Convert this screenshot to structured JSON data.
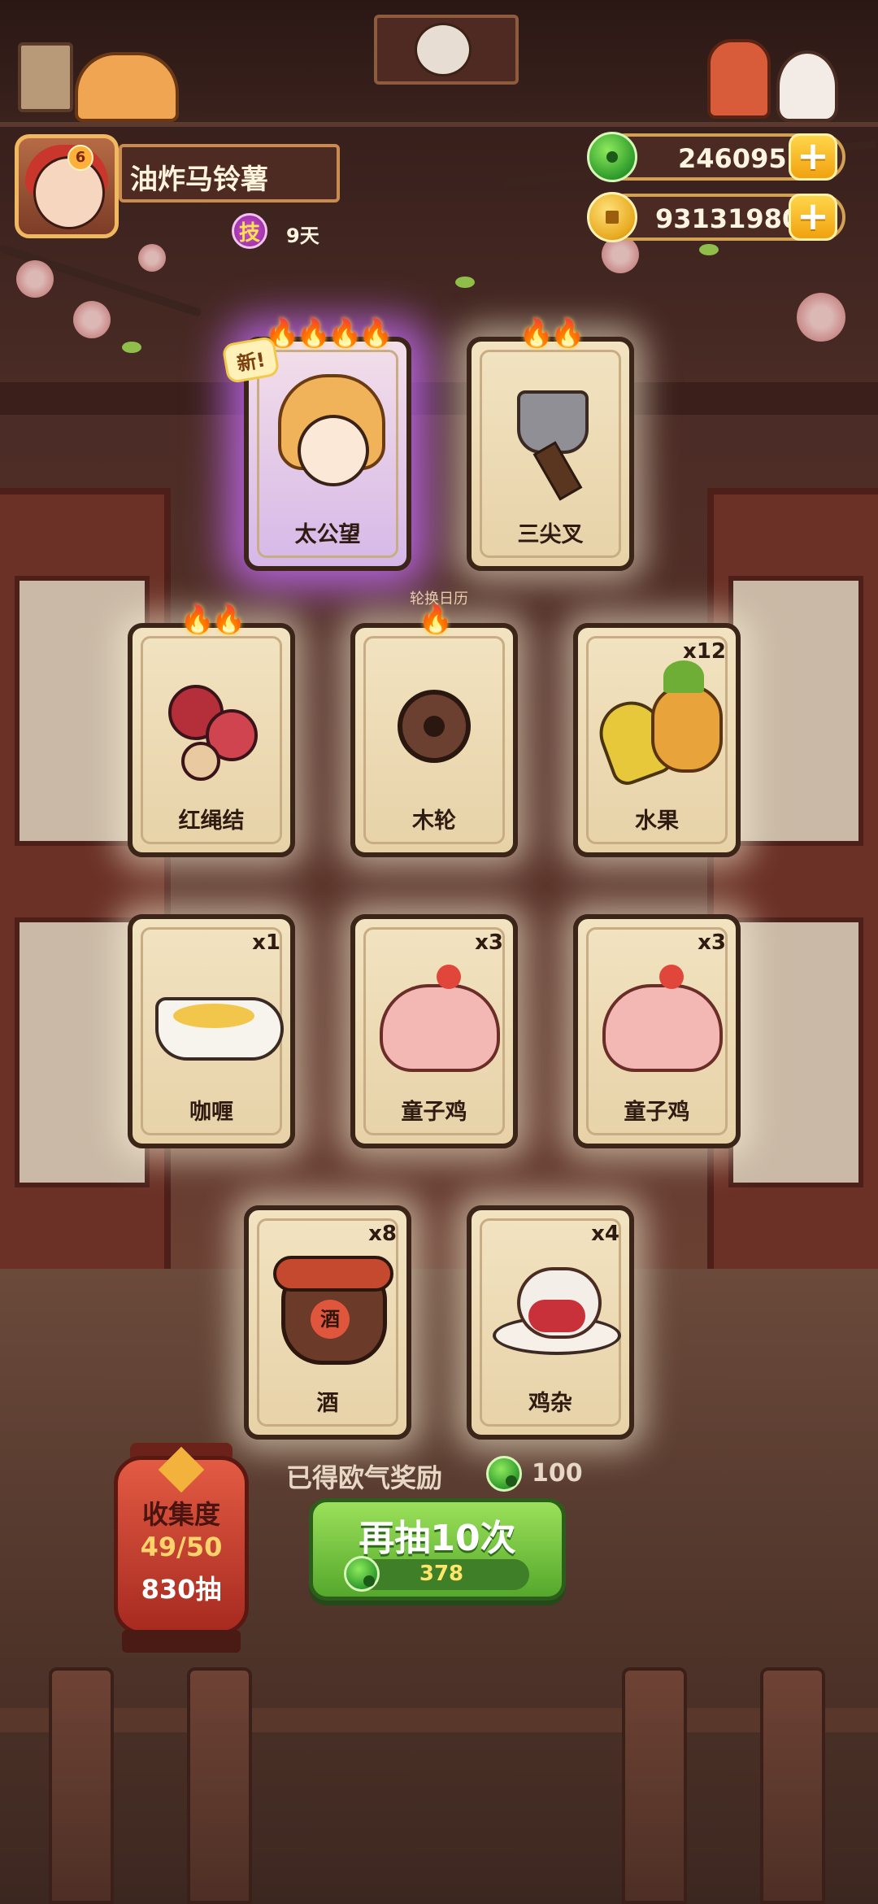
{
  "header": {
    "player_name": "油炸马铃薯",
    "avatar_level": "6",
    "skill_badge": "技",
    "days": "9天",
    "jade_amount": "246095",
    "coin_amount": "93131980",
    "plus_label": "+"
  },
  "cards_row1": [
    {
      "name": "太公望",
      "flames": "🔥🔥🔥🔥",
      "new_tag": "新!",
      "art": "character"
    },
    {
      "name": "三尖叉",
      "flames": "🔥🔥",
      "art": "trident"
    }
  ],
  "calendar_label": "轮换日历",
  "cards_row2": [
    {
      "name": "红绳结",
      "flames": "🔥🔥",
      "art": "red-knot"
    },
    {
      "name": "木轮",
      "flames": "🔥",
      "art": "wooden-wheel"
    },
    {
      "name": "水果",
      "qty": "x12",
      "art": "fruit"
    }
  ],
  "cards_row3": [
    {
      "name": "咖喱",
      "qty": "x1",
      "art": "curry"
    },
    {
      "name": "童子鸡",
      "qty": "x3",
      "art": "chicken"
    },
    {
      "name": "童子鸡",
      "qty": "x3",
      "art": "chicken"
    }
  ],
  "cards_row4": [
    {
      "name": "酒",
      "qty": "x8",
      "art": "wine-jar",
      "jar_char": "酒"
    },
    {
      "name": "鸡杂",
      "qty": "x4",
      "art": "chicken-giblets"
    }
  ],
  "reward": {
    "label": "已得欧气奖励",
    "amount": "100"
  },
  "draw_button": {
    "label": "再抽10次",
    "cost": "378"
  },
  "collection": {
    "title": "收集度",
    "progress": "49/50",
    "draws": "830抽"
  },
  "colors": {
    "accent_green": "#55a82c",
    "gold": "#f1a20f",
    "glow_purple": "#c86eff"
  }
}
